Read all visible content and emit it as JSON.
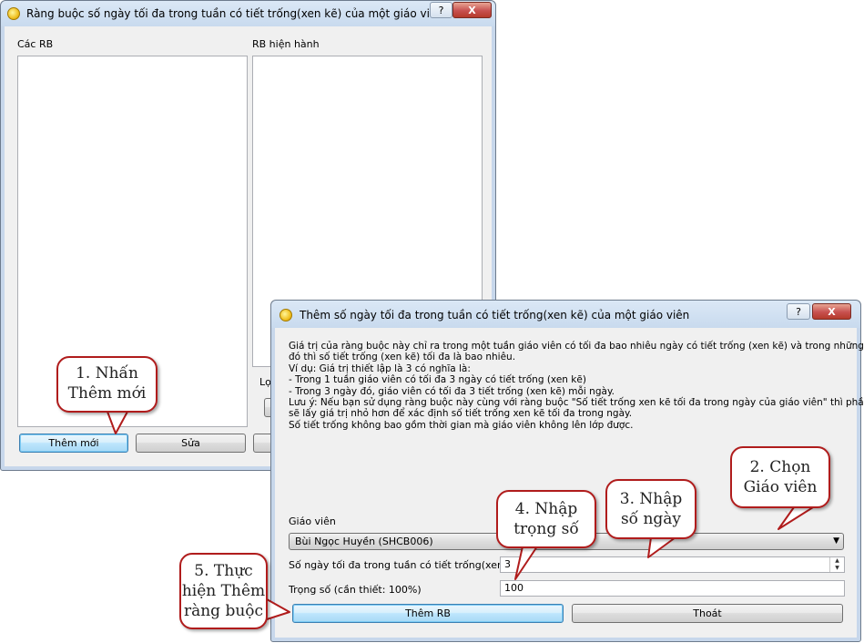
{
  "main_window": {
    "title": "Ràng buộc số ngày tối đa trong tuần có tiết trống(xen kẽ) của một giáo viên",
    "left_list_label": "Các RB",
    "right_list_label": "RB hiện hành",
    "filter_label_partial": "Lọc",
    "add_button": "Thêm mới",
    "edit_button": "Sửa",
    "help_label": "?",
    "close_label": "X"
  },
  "dialog": {
    "title": "Thêm số ngày tối đa trong tuần có tiết trống(xen kẽ) của một giáo viên",
    "help_label": "?",
    "close_label": "X",
    "description": "Giá trị của ràng buộc này chỉ ra trong một tuần giáo viên có tối đa bao nhiêu ngày có tiết trống (xen kẽ) và trong những ngày\nđó thì số tiết trống (xen kẽ) tối đa là bao nhiêu.\nVí dụ: Giá trị thiết lập là 3 có nghĩa là:\n- Trong 1 tuần giáo viên có tối đa 3 ngày có tiết trống (xen kẽ)\n- Trong 3 ngày đó, giáo viên có tối đa 3 tiết trống (xen kẽ) mỗi ngày.\nLưu ý: Nếu bạn sử dụng ràng buộc này cùng với ràng buộc \"Số tiết trống xen kẽ tối đa trong ngày của giáo viên\" thì phần mềm\nsẽ lấy giá trị nhỏ hơn để xác định số tiết trống xen kẽ tối đa trong ngày.\nSố tiết trống không bao gồm thời gian mà giáo viên không lên lớp được.",
    "teacher_label": "Giáo viên",
    "teacher_selected": "Bùi Ngọc Huyền (SHCB006)",
    "days_label": "Số ngày tối đa trong tuần có tiết trống(xen kẽ)",
    "days_value": "3",
    "weight_label": "Trọng số (cần thiết: 100%)",
    "weight_value": "100",
    "add_button": "Thêm RB",
    "exit_button": "Thoát"
  },
  "callouts": {
    "step1": [
      "1. Nhấn",
      "Thêm mới"
    ],
    "step2": [
      "2. Chọn",
      "Giáo viên"
    ],
    "step3": [
      "3. Nhập",
      "số ngày"
    ],
    "step4": [
      "4. Nhập",
      "trọng số"
    ],
    "step5": [
      "5. Thực",
      "hiện Thêm",
      "ràng buộc"
    ]
  },
  "colors": {
    "callout_border": "#b01c1c",
    "titlebar": "#c8daee"
  }
}
